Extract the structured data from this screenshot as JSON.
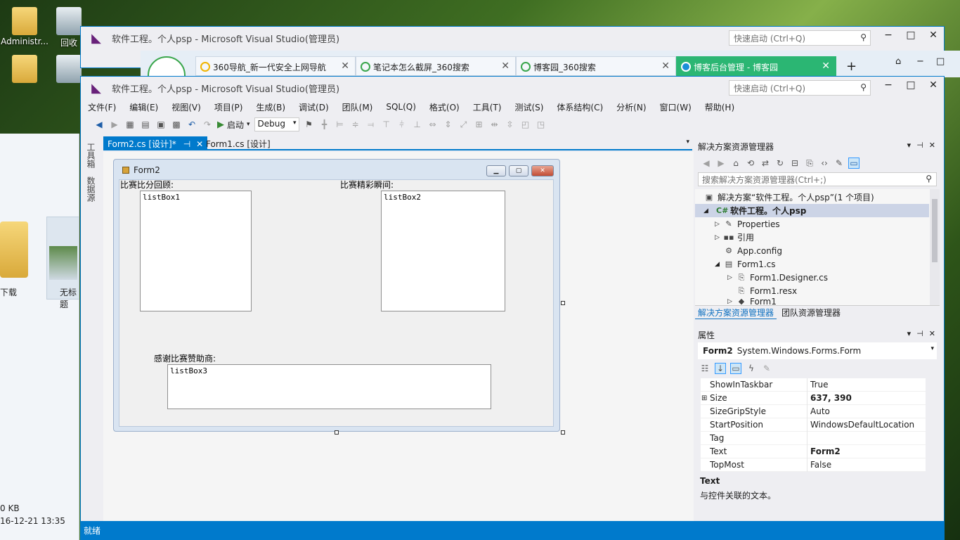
{
  "desktop": {
    "icons": [
      {
        "label": "Administr..."
      },
      {
        "label": "回收"
      }
    ]
  },
  "explorer": {
    "item1_label": "下载",
    "item2_label": "无标题",
    "size_text": "0 KB",
    "date_text": "16-12-21 13:35"
  },
  "bg_vs": {
    "title": "软件工程。个人psp - Microsoft Visual Studio(管理员)",
    "quick_launch": "快速启动 (Ctrl+Q)"
  },
  "browser": {
    "tabs": [
      {
        "label": "360导航_新一代安全上网导航"
      },
      {
        "label": "笔记本怎么截屏_360搜索"
      },
      {
        "label": "博客园_360搜索"
      },
      {
        "label": "博客后台管理 - 博客园"
      }
    ],
    "new_tab": "+"
  },
  "vs": {
    "title": "软件工程。个人psp - Microsoft Visual Studio(管理员)",
    "quick_launch": "快速启动 (Ctrl+Q)",
    "menu": [
      "文件(F)",
      "编辑(E)",
      "视图(V)",
      "项目(P)",
      "生成(B)",
      "调试(D)",
      "团队(M)",
      "SQL(Q)",
      "格式(O)",
      "工具(T)",
      "测试(S)",
      "体系结构(C)",
      "分析(N)",
      "窗口(W)",
      "帮助(H)"
    ],
    "toolbar": {
      "start_label": "启动",
      "config": "Debug"
    },
    "side_tabs": [
      "工具箱",
      "数据源"
    ],
    "doc_tabs": [
      {
        "label": "Form2.cs [设计]*"
      },
      {
        "label": "Form1.cs [设计]"
      }
    ],
    "status": "就绪"
  },
  "form": {
    "title": "Form2",
    "label1": "比赛比分回顾:",
    "label2": "比赛精彩瞬间:",
    "label3": "感谢比赛赞助商:",
    "listbox1": "listBox1",
    "listbox2": "listBox2",
    "listbox3": "listBox3"
  },
  "solution": {
    "title": "解决方案资源管理器",
    "search_placeholder": "搜索解决方案资源管理器(Ctrl+;)",
    "items": [
      {
        "label": "解决方案“软件工程。个人psp”(1 个项目)"
      },
      {
        "label": "软件工程。个人psp"
      },
      {
        "label": "Properties"
      },
      {
        "label": "引用"
      },
      {
        "label": "App.config"
      },
      {
        "label": "Form1.cs"
      },
      {
        "label": "Form1.Designer.cs"
      },
      {
        "label": "Form1.resx"
      },
      {
        "label": "Form1"
      }
    ],
    "tabs": [
      "解决方案资源管理器",
      "团队资源管理器"
    ]
  },
  "properties": {
    "title": "属性",
    "object_name": "Form2",
    "object_type": "System.Windows.Forms.Form",
    "rows": [
      {
        "name": "ShowInTaskbar",
        "value": "True"
      },
      {
        "name": "Size",
        "value": "637, 390"
      },
      {
        "name": "SizeGripStyle",
        "value": "Auto"
      },
      {
        "name": "StartPosition",
        "value": "WindowsDefaultLocation"
      },
      {
        "name": "Tag",
        "value": ""
      },
      {
        "name": "Text",
        "value": "Form2"
      },
      {
        "name": "TopMost",
        "value": "False"
      }
    ],
    "desc_title": "Text",
    "desc_text": "与控件关联的文本。"
  },
  "colors": {
    "accent": "#007acc",
    "vs_purple": "#68217a",
    "browser_active": "#2bb673"
  }
}
